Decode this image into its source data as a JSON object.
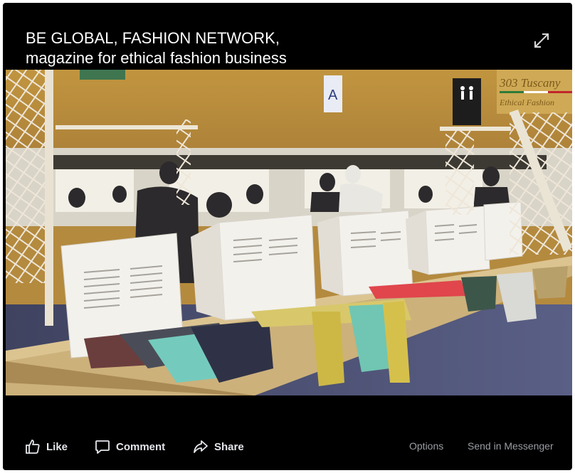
{
  "video": {
    "title_line1": "BE GLOBAL, FASHION NETWORK,",
    "title_line2": "magazine for ethical fashion business",
    "scene_sign_letter": "A",
    "scene_sign_brand_line1": "303 Tuscany",
    "scene_sign_brand_line2": "Ethical Fashion"
  },
  "actions": {
    "like": "Like",
    "comment": "Comment",
    "share": "Share",
    "options": "Options",
    "send": "Send in Messenger"
  }
}
